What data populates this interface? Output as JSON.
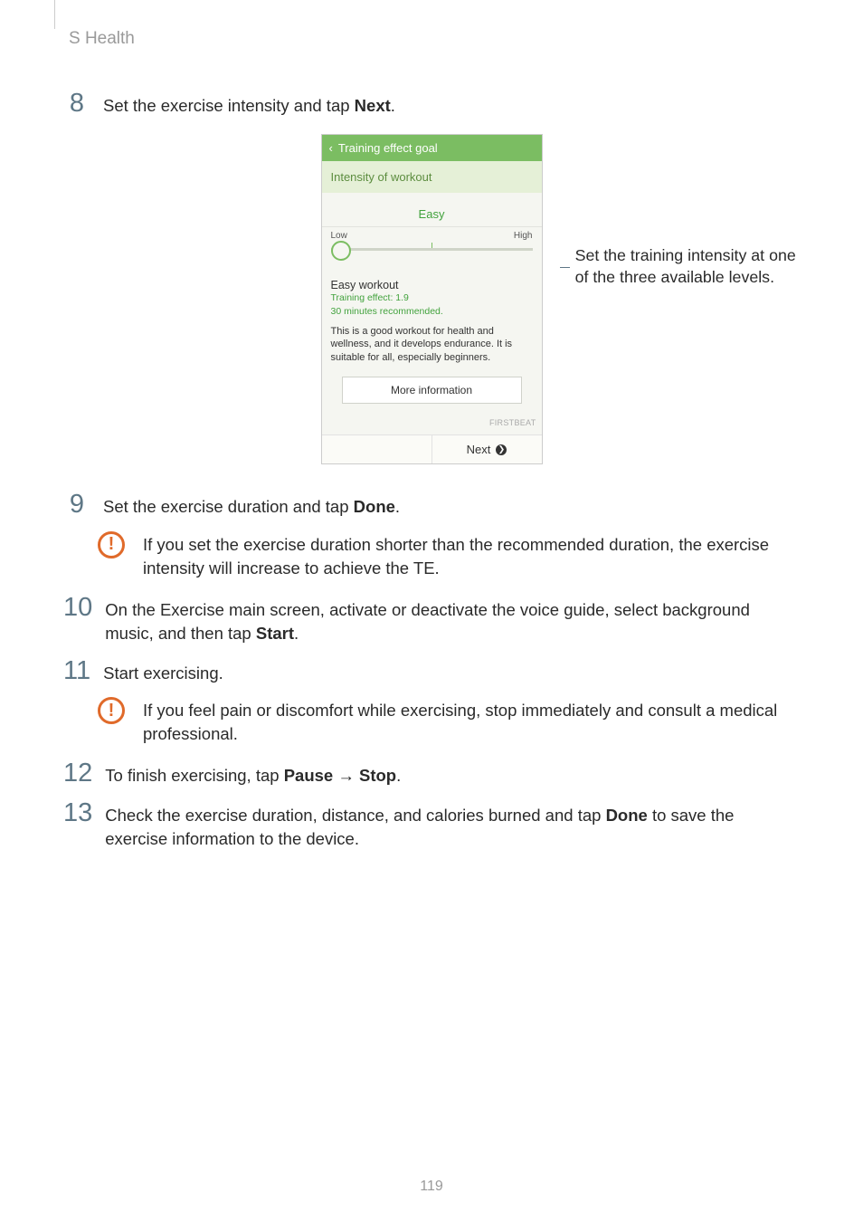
{
  "header": {
    "title": "S Health"
  },
  "steps": {
    "s8": {
      "num": "8",
      "pre": "Set the exercise intensity and tap ",
      "bold": "Next",
      "post": "."
    },
    "s9": {
      "num": "9",
      "pre": "Set the exercise duration and tap ",
      "bold": "Done",
      "post": "."
    },
    "s10": {
      "num": "10",
      "pre": "On the Exercise main screen, activate or deactivate the voice guide, select background music, and then tap ",
      "bold": "Start",
      "post": "."
    },
    "s11": {
      "num": "11",
      "text": "Start exercising."
    },
    "s12": {
      "num": "12",
      "pre": "To finish exercising, tap ",
      "bold1": "Pause",
      "sep": " → ",
      "bold2": "Stop",
      "post": "."
    },
    "s13": {
      "num": "13",
      "pre": "Check the exercise duration, distance, and calories burned and tap ",
      "bold": "Done",
      "post": " to save the exercise information to the device."
    }
  },
  "notices": {
    "n1": "If you set the exercise duration shorter than the recommended duration, the exercise intensity will increase to achieve the TE.",
    "n2": "If you feel pain or discomfort while exercising, stop immediately and consult a medical professional."
  },
  "callout": "Set the training intensity at one of the three available levels.",
  "phone": {
    "title": "Training effect goal",
    "subhead": "Intensity of workout",
    "easy": "Easy",
    "low": "Low",
    "high": "High",
    "workout": "Easy workout",
    "te_line1": "Training effect: 1.9",
    "te_line2": "30 minutes recommended.",
    "desc": "This is a good workout for health and wellness, and it develops endurance. It is suitable for all, especially beginners.",
    "more": "More information",
    "brand": "FIRSTBEAT",
    "next": "Next"
  },
  "page_number": "119"
}
